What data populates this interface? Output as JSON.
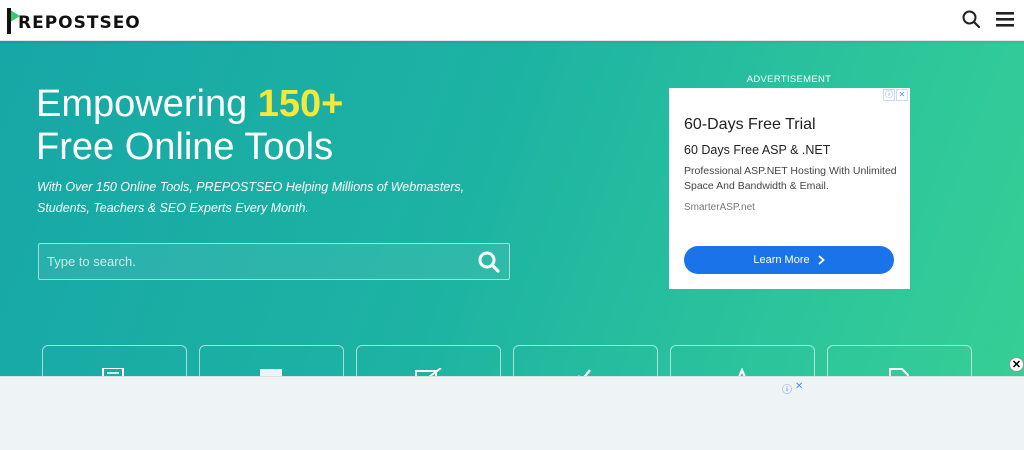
{
  "header": {
    "logo_text": "REPOSTSEO",
    "logo_letter": "P",
    "search_icon": "search-icon",
    "menu_icon": "hamburger-menu-icon"
  },
  "hero": {
    "headline_part1": "Empowering ",
    "headline_accent": "150+",
    "headline_line2": "Free Online Tools",
    "subtext": "With Over 150 Online Tools, PREPOSTSEO Helping Millions of Webmasters, Students, Teachers & SEO Experts Every Month.",
    "search": {
      "placeholder": "Type to search.",
      "value": ""
    }
  },
  "advertisement": {
    "label": "ADVERTISEMENT",
    "title": "60-Days Free Trial",
    "subtitle": "60 Days Free ASP & .NET",
    "description": "Professional ASP.NET Hosting With Unlimited Space And Bandwidth & Email.",
    "domain": "SmarterASP.net",
    "cta": "Learn More",
    "tag_info": "ⓘ",
    "tag_close": "✕"
  },
  "tool_cards": [
    {
      "icon": "document-icon"
    },
    {
      "icon": "image-icon"
    },
    {
      "icon": "edit-icon"
    },
    {
      "icon": "check-icon"
    },
    {
      "icon": "text-icon"
    },
    {
      "icon": "file-icon"
    }
  ],
  "bottom_ad": {
    "tag_info": "ⓘ",
    "tag_close": "✕",
    "close": "✕"
  },
  "colors": {
    "hero_start": "#17a7a6",
    "hero_end": "#37cf95",
    "accent": "#f4e83a",
    "cta_blue": "#1a73e8",
    "logo_green": "#2ecc71"
  }
}
